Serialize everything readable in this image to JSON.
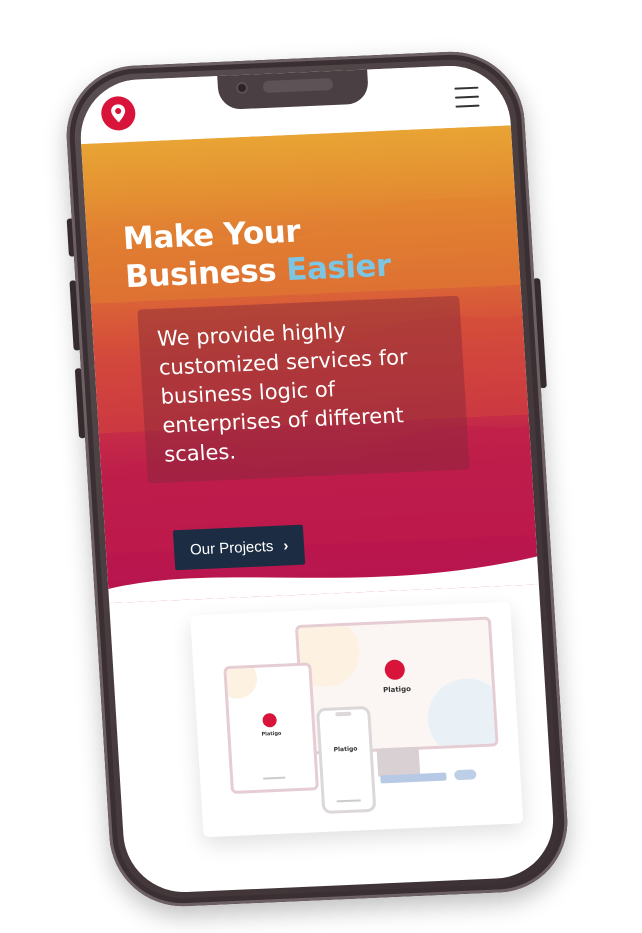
{
  "header": {
    "logo_icon": "pin-logo-icon",
    "menu_icon": "hamburger-menu-icon"
  },
  "hero": {
    "title_line1": "Make Your",
    "title_line2_plain": "Business ",
    "title_line2_accent": "Easier",
    "description": "We provide highly customized services for business logic of enterprises of different scales.",
    "cta_label": "Our Projects",
    "cta_icon": "chevron-right-icon"
  },
  "illustration": {
    "monitor_brand": "Platigo",
    "tablet_brand": "Platigo",
    "phone_brand": "Platigo"
  },
  "colors": {
    "brand_red": "#d8143a",
    "accent_blue": "#7cc6e3",
    "cta_navy": "#1b2c43",
    "hero_top": "#e8a434",
    "hero_bottom": "#b8134e",
    "phone_frame": "#4a3e41"
  }
}
